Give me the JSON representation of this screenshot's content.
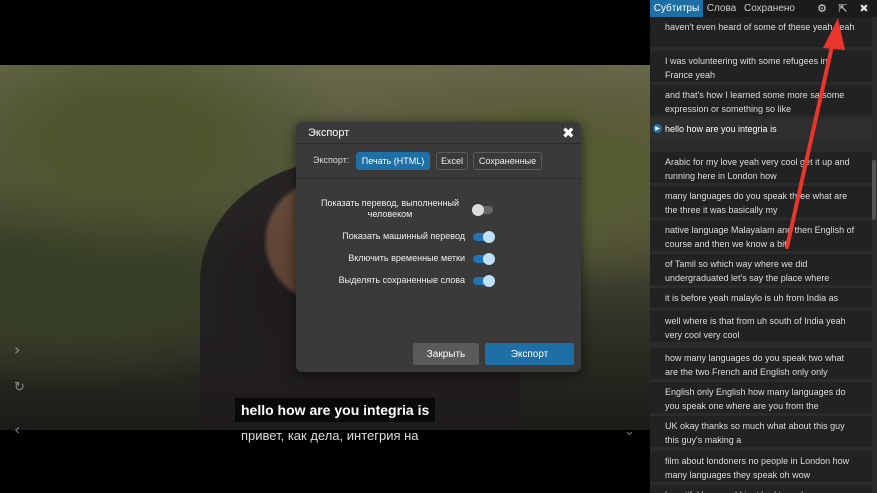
{
  "video": {
    "subtitle_current": "hello how are you integria is",
    "subtitle_translation": "привет, как дела, интегрия на"
  },
  "modal": {
    "title": "Экспорт",
    "close_icon": "close-icon",
    "format_label": "Экспорт:",
    "formats": [
      "Печать (HTML)",
      "Excel",
      "Сохраненные"
    ],
    "active_format": "Печать (HTML)",
    "options": [
      {
        "label": "Показать перевод, выполненный человеком",
        "enabled": false
      },
      {
        "label": "Показать машинный перевод",
        "enabled": true
      },
      {
        "label": "Включить временные метки",
        "enabled": true
      },
      {
        "label": "Выделять сохраненные слова",
        "enabled": true
      }
    ],
    "close_button": "Закрыть",
    "export_button": "Экспорт"
  },
  "panel": {
    "tabs": [
      "Субтитры",
      "Слова",
      "Сохранено"
    ],
    "active_tab": "Субтитры",
    "icons": [
      "gear-icon",
      "export-icon",
      "close-icon"
    ],
    "subtitles": [
      "haven't even heard of some of these yeah yeah",
      "I was volunteering with some refugees in France yeah",
      "and that's how I learned some more sa some expression or something so like",
      "hello how are you integria is",
      "Arabic for my love yeah very cool get it up and running here in London how",
      "many languages do you speak three what are the three it was basically my",
      "native language Malayalam and then English of course and then we know a bit",
      "of Tamil so which way where we did undergraduated let's say the place where",
      "it is before yeah malaylo is uh from India as",
      "well where is that from uh south of India yeah very cool very cool",
      "how many languages do you speak two what are the two French and English only only",
      "English only English how many languages do you speak one where are you from the",
      "UK okay thanks so much what about this guy this guy's making a",
      "film about londoners no people in London how many languages they speak oh wow",
      "beautiful hara and I just had to embarrass"
    ],
    "current_index": 3
  },
  "colors": {
    "accent": "#1e6fa6",
    "annotation_arrow": "#e8352e"
  }
}
